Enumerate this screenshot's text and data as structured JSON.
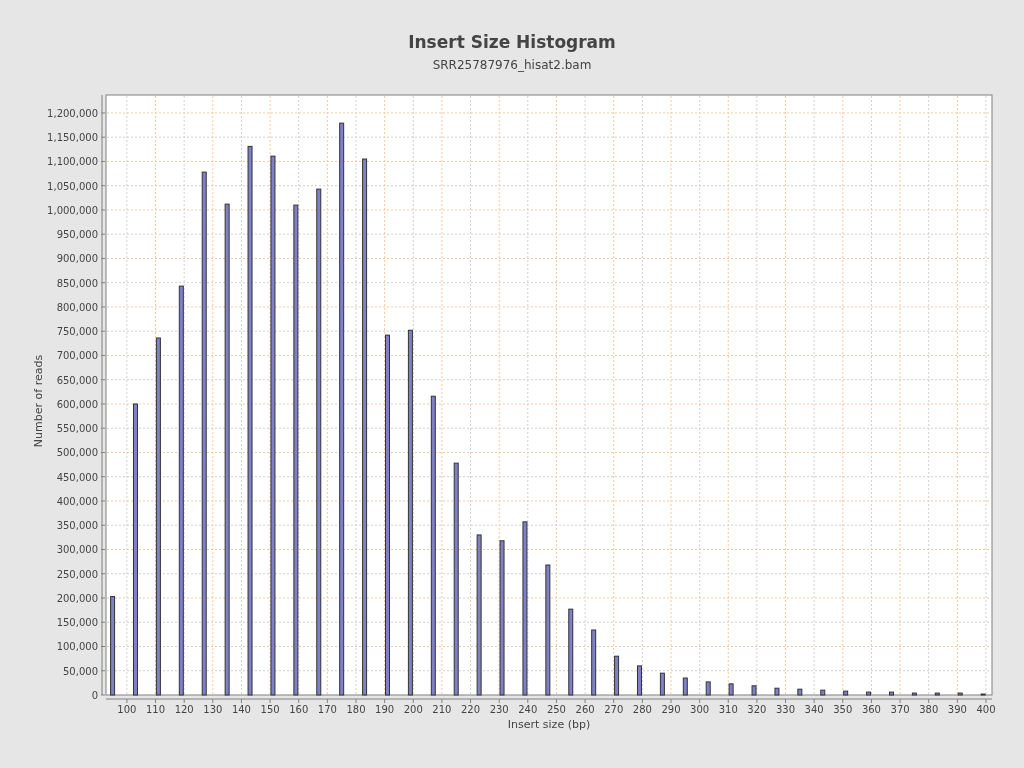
{
  "chart_data": {
    "type": "bar",
    "title": "Insert Size Histogram",
    "subtitle": "SRR25787976_hisat2.bam",
    "xlabel": "Insert size (bp)",
    "ylabel": "Number of reads",
    "x": [
      95,
      103,
      111,
      119,
      127,
      135,
      143,
      151,
      159,
      167,
      175,
      183,
      191,
      199,
      207,
      215,
      223,
      231,
      239,
      247,
      255,
      263,
      271,
      279,
      287,
      295,
      303,
      311,
      319,
      327,
      335,
      343,
      351,
      359,
      367,
      375,
      383,
      391,
      399
    ],
    "series": [
      {
        "color": "#8080c8",
        "values": [
          203000,
          600000,
          736000,
          843000,
          1078000,
          1012000,
          1131000,
          1111000,
          1010000,
          1043000,
          1179000,
          1105000,
          742000,
          752000,
          616000,
          478000,
          330000,
          318000,
          357000,
          268000,
          177000,
          134000,
          80000,
          60000,
          45000,
          35000,
          27000,
          23000,
          19000,
          14000,
          12000,
          10000,
          8000,
          6000,
          6000,
          4000,
          4000,
          4000,
          2000
        ]
      }
    ],
    "grid": true,
    "xlim": [
      92.7,
      402.1
    ],
    "ylim": [
      0,
      1237000
    ],
    "xticks": [
      100,
      110,
      120,
      130,
      140,
      150,
      160,
      170,
      180,
      190,
      200,
      210,
      220,
      230,
      240,
      250,
      260,
      270,
      280,
      290,
      300,
      310,
      320,
      330,
      340,
      350,
      360,
      370,
      380,
      390,
      400
    ],
    "yticks": [
      {
        "value": 0,
        "label": "0"
      },
      {
        "value": 50000,
        "label": "50,000"
      },
      {
        "value": 100000,
        "label": "100,000"
      },
      {
        "value": 150000,
        "label": "150,000"
      },
      {
        "value": 200000,
        "label": "200,000"
      },
      {
        "value": 250000,
        "label": "250,000"
      },
      {
        "value": 300000,
        "label": "300,000"
      },
      {
        "value": 350000,
        "label": "350,000"
      },
      {
        "value": 400000,
        "label": "400,000"
      },
      {
        "value": 450000,
        "label": "450,000"
      },
      {
        "value": 500000,
        "label": "500,000"
      },
      {
        "value": 550000,
        "label": "550,000"
      },
      {
        "value": 600000,
        "label": "600,000"
      },
      {
        "value": 650000,
        "label": "650,000"
      },
      {
        "value": 700000,
        "label": "700,000"
      },
      {
        "value": 750000,
        "label": "750,000"
      },
      {
        "value": 800000,
        "label": "800,000"
      },
      {
        "value": 850000,
        "label": "850,000"
      },
      {
        "value": 900000,
        "label": "900,000"
      },
      {
        "value": 950000,
        "label": "950,000"
      },
      {
        "value": 1000000,
        "label": "1,000,000"
      },
      {
        "value": 1050000,
        "label": "1,050,000"
      },
      {
        "value": 1100000,
        "label": "1,100,000"
      },
      {
        "value": 1150000,
        "label": "1,150,000"
      },
      {
        "value": 1200000,
        "label": "1,200,000"
      }
    ]
  }
}
